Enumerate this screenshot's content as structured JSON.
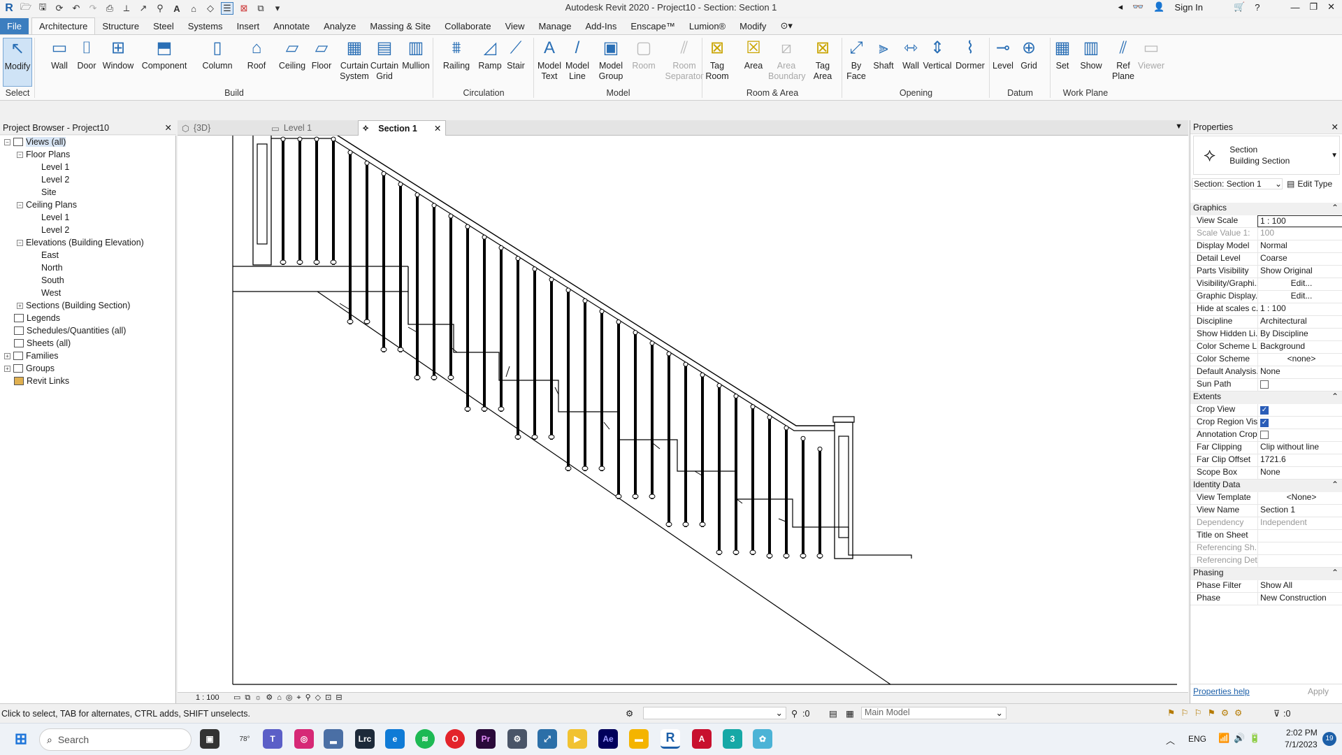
{
  "title": "Autodesk Revit 2020 - Project10 - Section: Section 1",
  "signin": "Sign In",
  "tabs": [
    "File",
    "Architecture",
    "Structure",
    "Steel",
    "Systems",
    "Insert",
    "Annotate",
    "Analyze",
    "Massing & Site",
    "Collaborate",
    "View",
    "Manage",
    "Add-Ins",
    "Enscape™",
    "Lumion®",
    "Modify"
  ],
  "ribbon": {
    "buttons": [
      {
        "label": "Modify",
        "icon": "cursor-icon"
      },
      {
        "label": "Wall",
        "icon": "wall-icon"
      },
      {
        "label": "Door",
        "icon": "door-icon"
      },
      {
        "label": "Window",
        "icon": "window-icon"
      },
      {
        "label": "Component",
        "icon": "component-icon"
      },
      {
        "label": "Column",
        "icon": "column-icon"
      },
      {
        "label": "Roof",
        "icon": "roof-icon"
      },
      {
        "label": "Ceiling",
        "icon": "ceiling-icon"
      },
      {
        "label": "Floor",
        "icon": "floor-icon"
      },
      {
        "label": "Curtain System",
        "icon": "curtain-system-icon"
      },
      {
        "label": "Curtain Grid",
        "icon": "curtain-grid-icon"
      },
      {
        "label": "Mullion",
        "icon": "mullion-icon"
      },
      {
        "label": "Railing",
        "icon": "railing-icon"
      },
      {
        "label": "Ramp",
        "icon": "ramp-icon"
      },
      {
        "label": "Stair",
        "icon": "stair-icon"
      },
      {
        "label": "Model Text",
        "icon": "model-text-icon"
      },
      {
        "label": "Model Line",
        "icon": "model-line-icon"
      },
      {
        "label": "Model Group",
        "icon": "model-group-icon"
      },
      {
        "label": "Room",
        "icon": "room-icon"
      },
      {
        "label": "Room Separator",
        "icon": "room-separator-icon"
      },
      {
        "label": "Tag Room",
        "icon": "tag-room-icon"
      },
      {
        "label": "Area",
        "icon": "area-icon"
      },
      {
        "label": "Area Boundary",
        "icon": "area-boundary-icon"
      },
      {
        "label": "Tag Area",
        "icon": "tag-area-icon"
      },
      {
        "label": "By Face",
        "icon": "by-face-icon"
      },
      {
        "label": "Shaft",
        "icon": "shaft-icon"
      },
      {
        "label": "Wall",
        "icon": "wall-opening-icon"
      },
      {
        "label": "Vertical",
        "icon": "vertical-icon"
      },
      {
        "label": "Dormer",
        "icon": "dormer-icon"
      },
      {
        "label": "Level",
        "icon": "level-icon"
      },
      {
        "label": "Grid",
        "icon": "grid-icon"
      },
      {
        "label": "Set",
        "icon": "set-icon"
      },
      {
        "label": "Show",
        "icon": "show-icon"
      },
      {
        "label": "Ref Plane",
        "icon": "ref-plane-icon"
      },
      {
        "label": "Viewer",
        "icon": "viewer-icon"
      }
    ],
    "panels": [
      "Select",
      "Build",
      "Circulation",
      "Model",
      "Room & Area",
      "Opening",
      "Datum",
      "Work Plane"
    ]
  },
  "project_browser": {
    "title": "Project Browser - Project10",
    "items": [
      {
        "label": "Views (all)",
        "level": 0,
        "toggle": "−"
      },
      {
        "label": "Floor Plans",
        "level": 1,
        "toggle": "−"
      },
      {
        "label": "Level 1",
        "level": 2
      },
      {
        "label": "Level 2",
        "level": 2
      },
      {
        "label": "Site",
        "level": 2
      },
      {
        "label": "Ceiling Plans",
        "level": 1,
        "toggle": "−"
      },
      {
        "label": "Level 1",
        "level": 2
      },
      {
        "label": "Level 2",
        "level": 2
      },
      {
        "label": "Elevations (Building Elevation)",
        "level": 1,
        "toggle": "−"
      },
      {
        "label": "East",
        "level": 2
      },
      {
        "label": "North",
        "level": 2
      },
      {
        "label": "South",
        "level": 2
      },
      {
        "label": "West",
        "level": 2
      },
      {
        "label": "Sections (Building Section)",
        "level": 1,
        "toggle": "+"
      },
      {
        "label": "Legends",
        "level": 0
      },
      {
        "label": "Schedules/Quantities (all)",
        "level": 0
      },
      {
        "label": "Sheets (all)",
        "level": 0
      },
      {
        "label": "Families",
        "level": 0,
        "toggle": "+"
      },
      {
        "label": "Groups",
        "level": 0,
        "toggle": "+"
      },
      {
        "label": "Revit Links",
        "level": 0
      }
    ]
  },
  "view_tabs": [
    {
      "label": "{3D}",
      "icon": "3d-view-icon"
    },
    {
      "label": "Level 1",
      "icon": "plan-view-icon"
    },
    {
      "label": "Section 1",
      "icon": "section-view-icon",
      "active": true
    }
  ],
  "view_scale": "1 : 100",
  "properties": {
    "title": "Properties",
    "type_name": "Section",
    "type_sub": "Building Section",
    "instance": "Section: Section 1",
    "edit_type": "Edit Type",
    "groups": [
      {
        "name": "Graphics",
        "rows": [
          {
            "k": "View Scale",
            "v": "1 : 100"
          },
          {
            "k": "Scale Value    1:",
            "v": "100",
            "dim": true
          },
          {
            "k": "Display Model",
            "v": "Normal"
          },
          {
            "k": "Detail Level",
            "v": "Coarse"
          },
          {
            "k": "Parts Visibility",
            "v": "Show Original"
          },
          {
            "k": "Visibility/Graphi...",
            "v": "Edit...",
            "btn": true
          },
          {
            "k": "Graphic Display...",
            "v": "Edit...",
            "btn": true
          },
          {
            "k": "Hide at scales c...",
            "v": "1 : 100"
          },
          {
            "k": "Discipline",
            "v": "Architectural"
          },
          {
            "k": "Show Hidden Li...",
            "v": "By Discipline"
          },
          {
            "k": "Color Scheme L...",
            "v": "Background"
          },
          {
            "k": "Color Scheme",
            "v": "<none>",
            "btn": true
          },
          {
            "k": "Default Analysis...",
            "v": "None"
          },
          {
            "k": "Sun Path",
            "chk": false
          }
        ]
      },
      {
        "name": "Extents",
        "rows": [
          {
            "k": "Crop View",
            "chk": true
          },
          {
            "k": "Crop Region Vis...",
            "chk": true
          },
          {
            "k": "Annotation Crop",
            "chk": false
          },
          {
            "k": "Far Clipping",
            "v": "Clip without line"
          },
          {
            "k": "Far Clip Offset",
            "v": "1721.6"
          },
          {
            "k": "Scope Box",
            "v": "None"
          }
        ]
      },
      {
        "name": "Identity Data",
        "rows": [
          {
            "k": "View Template",
            "v": "<None>",
            "btn": true
          },
          {
            "k": "View Name",
            "v": "Section 1"
          },
          {
            "k": "Dependency",
            "v": "Independent",
            "dim": true
          },
          {
            "k": "Title on Sheet",
            "v": ""
          },
          {
            "k": "Referencing Sh...",
            "v": "",
            "dim": true
          },
          {
            "k": "Referencing Det...",
            "v": "",
            "dim": true
          }
        ]
      },
      {
        "name": "Phasing",
        "rows": [
          {
            "k": "Phase Filter",
            "v": "Show All"
          },
          {
            "k": "Phase",
            "v": "New Construction"
          }
        ]
      }
    ],
    "help": "Properties help",
    "apply": "Apply"
  },
  "status": {
    "hint": "Click to select, TAB for alternates, CTRL adds, SHIFT unselects.",
    "filter_count": ":0",
    "model": "Main Model",
    "sel_count": ":0"
  },
  "taskbar": {
    "search": "Search",
    "weather": "78°",
    "lang": "ENG",
    "time": "2:02 PM",
    "date": "7/1/2023",
    "notif": "19"
  }
}
